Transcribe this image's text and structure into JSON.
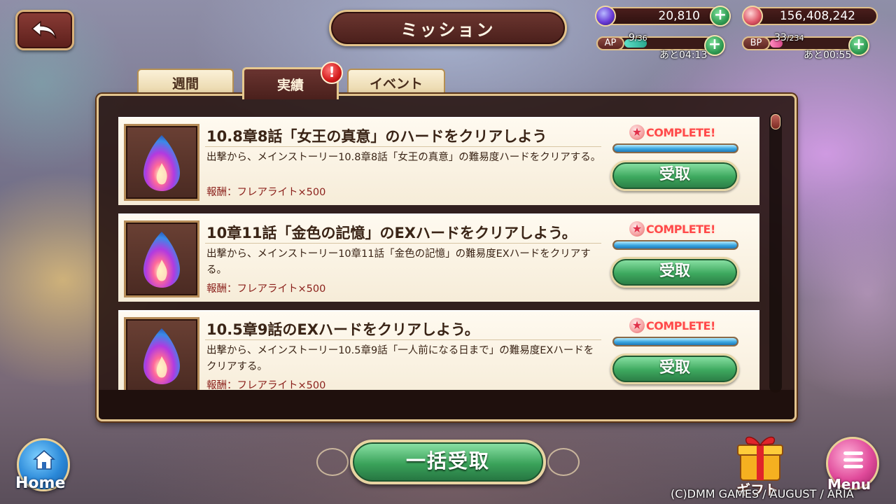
{
  "header": {
    "back_icon": "back-arrow-icon",
    "title": "ミッション"
  },
  "resources": {
    "gems": {
      "value": "20,810",
      "icon": "gem-icon",
      "plus": "+"
    },
    "coins": {
      "value": "156,408,242",
      "icon": "coin-icon",
      "plus": "+"
    },
    "ap": {
      "label": "AP",
      "current": "9",
      "max": "/36",
      "fill_fraction": 0.25,
      "timer": "あと04:13",
      "plus": "+"
    },
    "bp": {
      "label": "BP",
      "current": "33",
      "max": "/234",
      "fill_fraction": 0.14,
      "timer": "あと00:55",
      "plus": "+"
    }
  },
  "tabs": [
    {
      "label": "週間",
      "active": false
    },
    {
      "label": "実績",
      "active": true,
      "alert": "!"
    },
    {
      "label": "イベント",
      "active": false
    }
  ],
  "missions": [
    {
      "title": "10.8章8話「女王の真意」のハードをクリアしよう",
      "description": "出撃から、メインストーリー10.8章8話「女王の真意」の難易度ハードをクリアする。",
      "reward": "報酬：フレアライト×500",
      "status": "COMPLETE!",
      "progress_fraction": 1.0,
      "button": "受取",
      "icon": "flame-egg-icon"
    },
    {
      "title": "10章11話「金色の記憶」のEXハードをクリアしよう。",
      "description": "出撃から、メインストーリー10章11話「金色の記憶」の難易度EXハードをクリアする。",
      "reward": "報酬：フレアライト×500",
      "status": "COMPLETE!",
      "progress_fraction": 1.0,
      "button": "受取",
      "icon": "flame-egg-icon"
    },
    {
      "title": "10.5章9話のEXハードをクリアしよう。",
      "description": "出撃から、メインストーリー10.5章9話「一人前になる日まで」の難易度EXハードをクリアする。",
      "reward": "報酬：フレアライト×500",
      "status": "COMPLETE!",
      "progress_fraction": 1.0,
      "button": "受取",
      "icon": "flame-egg-icon"
    }
  ],
  "footer": {
    "bulk_claim": "一括受取",
    "home": "Home",
    "gift": "ギフト",
    "menu": "Menu",
    "copyright": "(C)DMM GAMES / AUGUST / ARIA"
  },
  "colors": {
    "accent_gold": "#e2c48e",
    "panel_brown": "#4a201c",
    "claim_green": "#3da85e",
    "complete_red": "#ff4a4a"
  }
}
